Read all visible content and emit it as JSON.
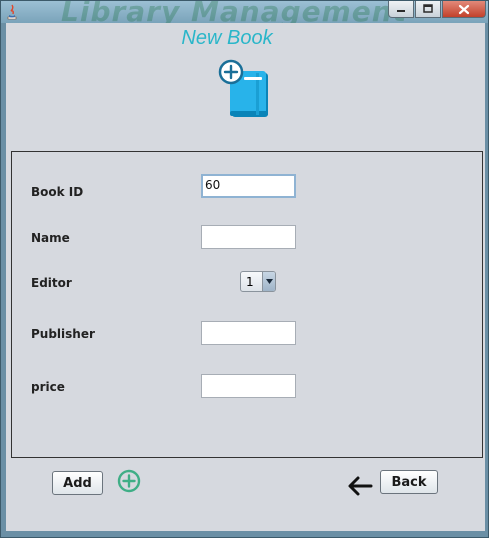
{
  "window": {
    "background_text": "Library Management",
    "controls": {
      "minimize": "minimize",
      "maximize": "maximize",
      "close": "close"
    }
  },
  "header": {
    "title": "New Book",
    "title_color": "#2ab6c9",
    "icon": "book-add-icon"
  },
  "form": {
    "book_id": {
      "label": "Book ID",
      "value": "60"
    },
    "name": {
      "label": "Name",
      "value": ""
    },
    "editor": {
      "label": "Editor",
      "selected": "1"
    },
    "publisher": {
      "label": "Publisher",
      "value": ""
    },
    "price": {
      "label": "price",
      "value": ""
    }
  },
  "actions": {
    "add_label": "Add",
    "add_icon": "plus-circle-icon",
    "back_label": "Back",
    "back_icon": "arrow-left-icon"
  }
}
